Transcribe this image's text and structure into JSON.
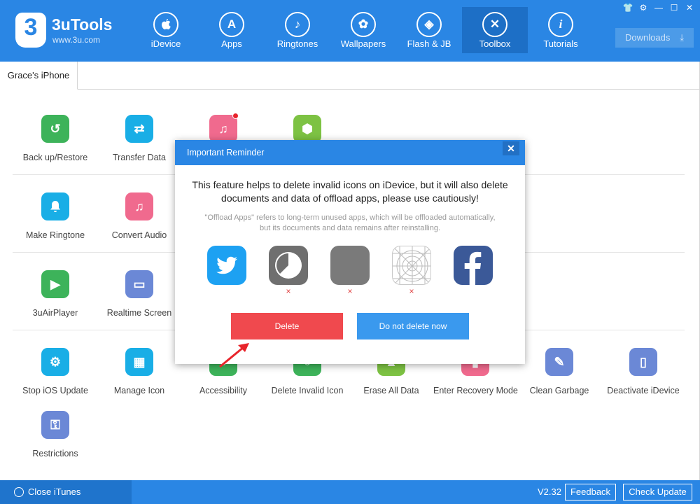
{
  "app": {
    "name": "3uTools",
    "url": "www.3u.com",
    "logo_glyph": "3"
  },
  "nav": [
    {
      "label": "iDevice",
      "icon": "apple-icon",
      "glyph": ""
    },
    {
      "label": "Apps",
      "icon": "app-store-icon",
      "glyph": "A"
    },
    {
      "label": "Ringtones",
      "icon": "bell-icon",
      "glyph": "♪"
    },
    {
      "label": "Wallpapers",
      "icon": "flower-icon",
      "glyph": "✿"
    },
    {
      "label": "Flash & JB",
      "icon": "dropbox-icon",
      "glyph": "◈"
    },
    {
      "label": "Toolbox",
      "icon": "tools-icon",
      "glyph": "✕"
    },
    {
      "label": "Tutorials",
      "icon": "info-icon",
      "glyph": "i"
    }
  ],
  "active_nav": "Toolbox",
  "window_controls": [
    "shirt-icon",
    "gear-icon",
    "minimize-icon",
    "maximize-icon",
    "close-icon"
  ],
  "downloads": {
    "label": "Downloads"
  },
  "device_tab": {
    "label": "Grace's iPhone"
  },
  "tools": {
    "row1": [
      {
        "label": "Back up/Restore",
        "icon": "backup-icon",
        "color": "#3db35a",
        "glyph": "↺"
      },
      {
        "label": "Transfer Data",
        "icon": "transfer-icon",
        "color": "#19aee6",
        "glyph": "⇄"
      },
      {
        "label": "",
        "icon": "itunes-settings-icon",
        "color": "#f06a8e",
        "glyph": "♫",
        "badge": true
      },
      {
        "label": "",
        "icon": "box-icon",
        "color": "#7dc243",
        "glyph": "⬢"
      }
    ],
    "row2": [
      {
        "label": "Make Ringtone",
        "icon": "bell-plus-icon",
        "color": "#19aee6",
        "glyph": "🔔"
      },
      {
        "label": "Convert Audio",
        "icon": "music-note-icon",
        "color": "#f06a8e",
        "glyph": "♫"
      }
    ],
    "row3": [
      {
        "label": "3uAirPlayer",
        "icon": "airplayer-icon",
        "color": "#3db35a",
        "glyph": "▶"
      },
      {
        "label": "Realtime Screen",
        "icon": "monitor-icon",
        "color": "#6b88d6",
        "glyph": "▭"
      }
    ],
    "row4": [
      {
        "label": "Stop iOS Update",
        "icon": "stop-update-icon",
        "color": "#19aee6",
        "glyph": "⚙"
      },
      {
        "label": "Manage Icon",
        "icon": "grid-icon",
        "color": "#19aee6",
        "glyph": "▦"
      },
      {
        "label": "Accessibility",
        "icon": "accessibility-icon",
        "color": "#3db35a",
        "glyph": "●"
      },
      {
        "label": "Delete Invalid Icon",
        "icon": "delete-icon",
        "color": "#3db35a",
        "glyph": "○"
      },
      {
        "label": "Erase All Data",
        "icon": "erase-icon",
        "color": "#7dc243",
        "glyph": "▲"
      },
      {
        "label": "Enter Recovery Mode",
        "icon": "recovery-icon",
        "color": "#f06a8e",
        "glyph": "▮"
      },
      {
        "label": "Clean Garbage",
        "icon": "broom-icon",
        "color": "#6b88d6",
        "glyph": "✎"
      },
      {
        "label": "Deactivate iDevice",
        "icon": "deactivate-icon",
        "color": "#6b88d6",
        "glyph": "▯"
      }
    ],
    "row5": [
      {
        "label": "Restrictions",
        "icon": "key-icon",
        "color": "#6b88d6",
        "glyph": "⚿"
      }
    ]
  },
  "modal": {
    "title": "Important Reminder",
    "close_glyph": "✕",
    "message": "This feature helps to delete invalid icons on iDevice, but it will also delete documents and data of offload apps, please use cautiously!",
    "note": "\"Offload Apps\" refers to long-term unused apps, which will be offloaded automatically, but its documents and data remains after reinstalling.",
    "apps": [
      {
        "icon": "twitter-icon",
        "marked": false
      },
      {
        "icon": "loading-app-icon",
        "marked": true
      },
      {
        "icon": "gray-app-icon",
        "marked": true
      },
      {
        "icon": "app-grid-placeholder-icon",
        "marked": true
      },
      {
        "icon": "facebook-icon",
        "marked": false
      }
    ],
    "x_glyph": "×",
    "delete_label": "Delete",
    "keep_label": "Do not delete now"
  },
  "footer": {
    "close_itunes": "Close iTunes",
    "version": "V2.32",
    "feedback": "Feedback",
    "check_update": "Check Update"
  }
}
